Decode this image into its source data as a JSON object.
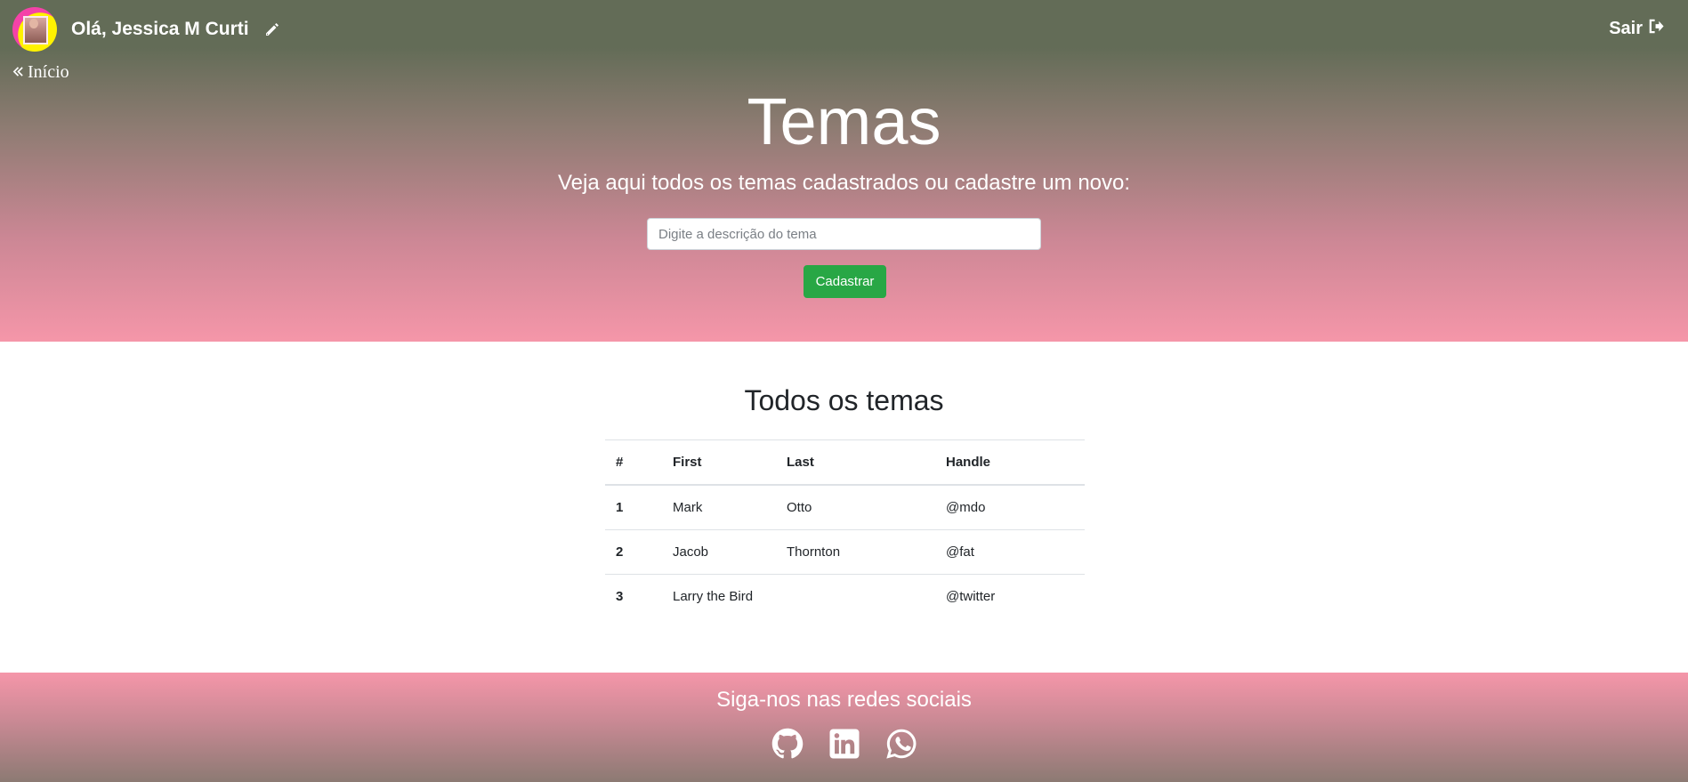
{
  "header": {
    "greeting": "Olá, Jessica M Curti",
    "logout_label": "Sair",
    "back_label": "Início"
  },
  "hero": {
    "title": "Temas",
    "subtitle": "Veja aqui todos os temas cadastrados ou cadastre um novo:",
    "input_placeholder": "Digite a descrição do tema",
    "input_value": "",
    "submit_label": "Cadastrar"
  },
  "list": {
    "title": "Todos os temas",
    "columns": [
      "#",
      "First",
      "Last",
      "Handle"
    ],
    "rows": [
      [
        "1",
        "Mark",
        "Otto",
        "@mdo"
      ],
      [
        "2",
        "Jacob",
        "Thornton",
        "@fat"
      ],
      [
        "3",
        "Larry the Bird",
        "",
        "@twitter"
      ]
    ]
  },
  "footer": {
    "title": "Siga-nos nas redes sociais",
    "icons": [
      "github-icon",
      "linkedin-icon",
      "whatsapp-icon"
    ]
  },
  "colors": {
    "header_top": "#636c57",
    "header_bottom": "#f596a9",
    "button_green": "#28a745"
  }
}
